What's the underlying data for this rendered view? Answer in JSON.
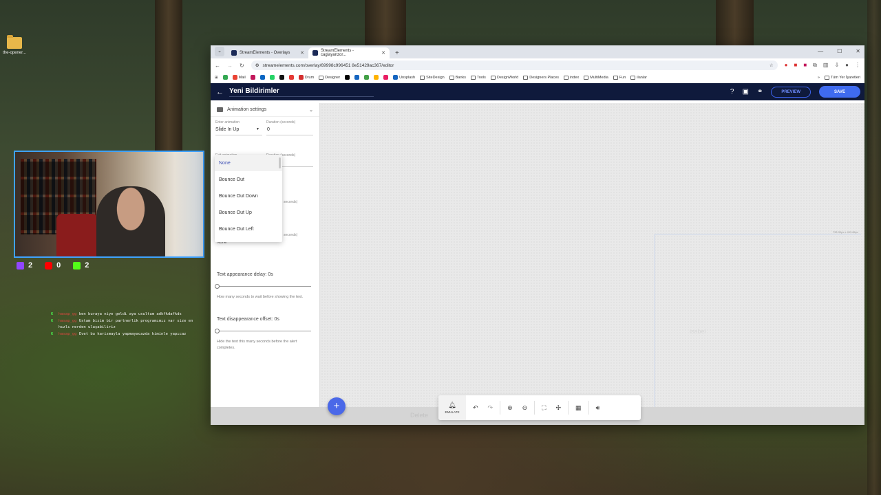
{
  "desktop": {
    "icon_label": "the-opener..."
  },
  "stream": {
    "counters": [
      {
        "platform": "twitch",
        "color": "#9146ff",
        "value": "2"
      },
      {
        "platform": "youtube",
        "color": "#ff0000",
        "value": "0"
      },
      {
        "platform": "kick",
        "color": "#53fc18",
        "value": "2"
      }
    ],
    "chat": [
      {
        "user": "hasap_gg",
        "text": "ben buraya niye geldi aya usultum adkfkdafkds"
      },
      {
        "user": "hasap_gg",
        "text": "Ustam bizim bir partnerlik programımız var size en hızlı nerden ulaşabiliriz"
      },
      {
        "user": "hasap_gg",
        "text": "Evet bu karizmayla yapmayacazda kiminle yapıcaz"
      }
    ]
  },
  "browser": {
    "tabs": [
      {
        "label": "StreamElements - Overlays",
        "active": false
      },
      {
        "label": "StreamElements - caglayanzor...",
        "active": true
      }
    ],
    "url": "streamelements.com/overlay/69998c996451 8e51429ac367/editor",
    "bookmarks": [
      "Mail",
      "Drum",
      "Designer",
      "Unsplash",
      "SiteDesign",
      "Banks",
      "Tools",
      "DesignWorld",
      "Designers Places",
      "index",
      "MultiMedia",
      "Fun",
      "ilanlar"
    ],
    "all_bookmarks": "Tüm Yer İşaretleri"
  },
  "app": {
    "overlay_name": "Yeni Bildirimler",
    "preview_label": "PREVIEW",
    "save_label": "SAVE",
    "panel": {
      "section_title": "Animation settings",
      "enter_label": "Enter animation",
      "enter_value": "Slide In Up",
      "duration_label": "Duration (seconds)",
      "duration_value": "0",
      "exit_label": "Exit animation",
      "exit_duration_label": "Duration (seconds)",
      "hidden_seconds_1": "seconds)",
      "hidden_seconds_2": "seconds)",
      "partial_value": "None",
      "dropdown_options": [
        "None",
        "Bounce Out",
        "Bounce Out Down",
        "Bounce Out Up",
        "Bounce Out Left"
      ],
      "selected_option": "None",
      "text_delay_label": "Text appearance delay: 0s",
      "text_delay_value": 0,
      "text_delay_help": "How many seconds to wait before showing the text.",
      "text_offset_label": "Text disappearance offset: 0s",
      "text_offset_value": 0,
      "text_offset_help": "Hide the text this many seconds before the alert completes."
    },
    "canvas": {
      "stage_size": "733.30px x 403.86px",
      "ghost_text": "isabel",
      "ghost_delete": "Delete"
    },
    "toolbar": {
      "emulate_label": "EMULATE"
    }
  }
}
